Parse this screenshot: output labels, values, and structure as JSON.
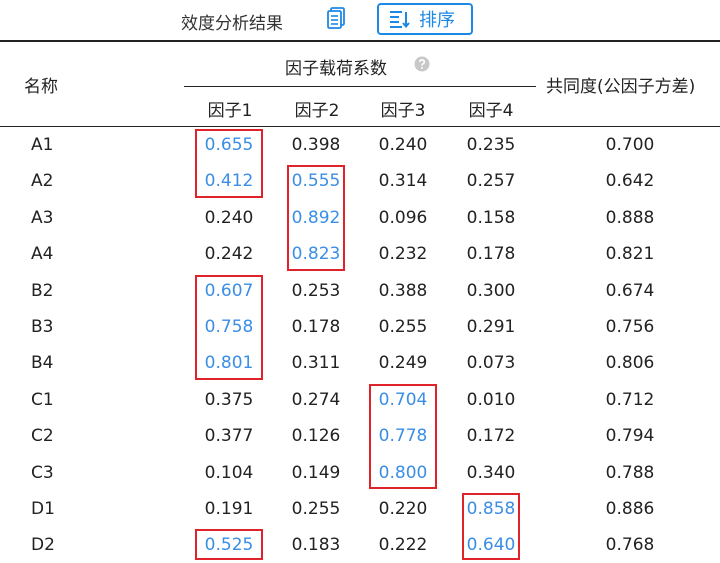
{
  "toolbar": {
    "title": "效度分析结果",
    "copy_icon": "copy-icon",
    "sort_label": "排序",
    "sort_icon": "sort-lines-icon"
  },
  "table": {
    "name_header": "名称",
    "group_header": "因子载荷系数",
    "help_icon": "question-circle-icon",
    "factor_headers": [
      "因子1",
      "因子2",
      "因子3",
      "因子4"
    ],
    "communality_header": "共同度(公因子方差)",
    "highlight_color": "#3a8ee6",
    "box_color": "#e0232b",
    "rows": [
      {
        "name": "A1",
        "f": [
          "0.655",
          "0.398",
          "0.240",
          "0.235"
        ],
        "comm": "0.700",
        "hl": 0
      },
      {
        "name": "A2",
        "f": [
          "0.412",
          "0.555",
          "0.314",
          "0.257"
        ],
        "comm": "0.642",
        "hl": [
          0,
          1
        ]
      },
      {
        "name": "A3",
        "f": [
          "0.240",
          "0.892",
          "0.096",
          "0.158"
        ],
        "comm": "0.888",
        "hl": 1
      },
      {
        "name": "A4",
        "f": [
          "0.242",
          "0.823",
          "0.232",
          "0.178"
        ],
        "comm": "0.821",
        "hl": 1
      },
      {
        "name": "B2",
        "f": [
          "0.607",
          "0.253",
          "0.388",
          "0.300"
        ],
        "comm": "0.674",
        "hl": 0
      },
      {
        "name": "B3",
        "f": [
          "0.758",
          "0.178",
          "0.255",
          "0.291"
        ],
        "comm": "0.756",
        "hl": 0
      },
      {
        "name": "B4",
        "f": [
          "0.801",
          "0.311",
          "0.249",
          "0.073"
        ],
        "comm": "0.806",
        "hl": 0
      },
      {
        "name": "C1",
        "f": [
          "0.375",
          "0.274",
          "0.704",
          "0.010"
        ],
        "comm": "0.712",
        "hl": 2
      },
      {
        "name": "C2",
        "f": [
          "0.377",
          "0.126",
          "0.778",
          "0.172"
        ],
        "comm": "0.794",
        "hl": 2
      },
      {
        "name": "C3",
        "f": [
          "0.104",
          "0.149",
          "0.800",
          "0.340"
        ],
        "comm": "0.788",
        "hl": 2
      },
      {
        "name": "D1",
        "f": [
          "0.191",
          "0.255",
          "0.220",
          "0.858"
        ],
        "comm": "0.886",
        "hl": 3
      },
      {
        "name": "D2",
        "f": [
          "0.525",
          "0.183",
          "0.222",
          "0.640"
        ],
        "comm": "0.768",
        "hl": [
          0,
          3
        ]
      }
    ],
    "boxes": [
      {
        "col": 0,
        "rows": [
          0,
          1
        ]
      },
      {
        "col": 1,
        "rows": [
          1,
          3
        ]
      },
      {
        "col": 0,
        "rows": [
          4,
          6
        ]
      },
      {
        "col": 2,
        "rows": [
          7,
          9
        ]
      },
      {
        "col": 3,
        "rows": [
          10,
          11
        ]
      },
      {
        "col": 0,
        "rows": [
          11,
          11
        ]
      }
    ]
  }
}
